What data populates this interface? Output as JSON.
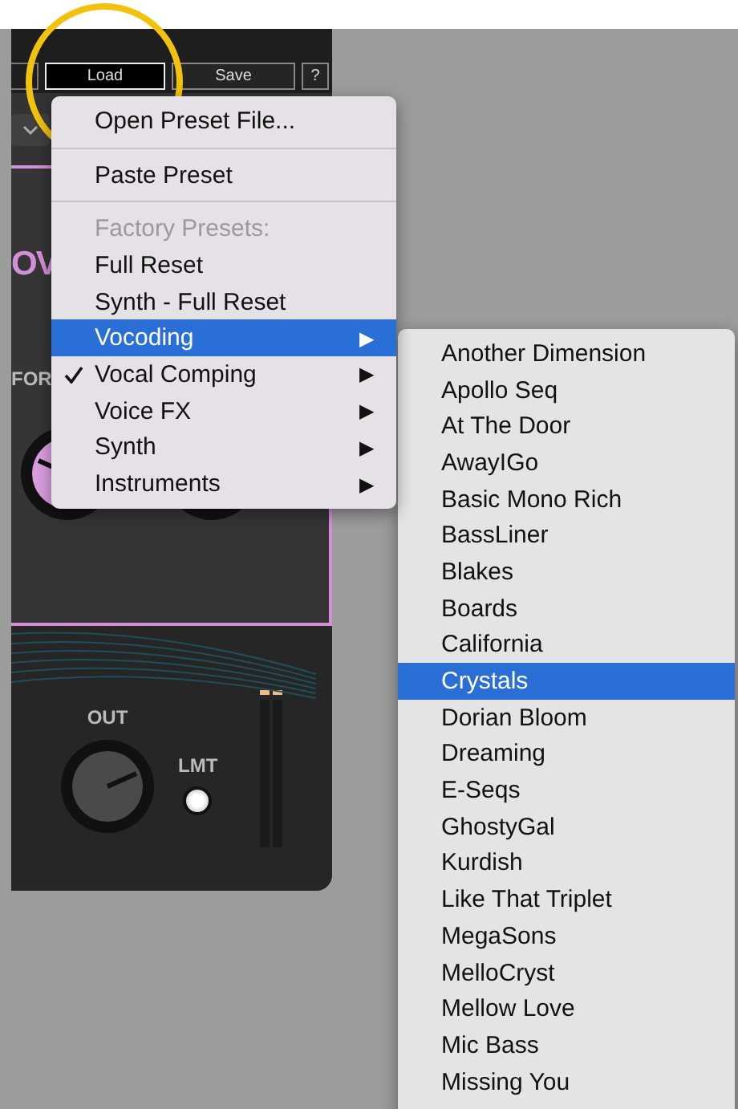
{
  "plugin": {
    "toolbar": [
      {
        "label": "Load",
        "active": true
      },
      {
        "label": "Save",
        "active": false
      },
      {
        "label": "?",
        "active": false
      }
    ],
    "title_fragment": "OV",
    "knob_label": "FOR",
    "output": {
      "label": "OUT"
    },
    "limiter": {
      "label": "LMT",
      "on": true
    }
  },
  "menu": {
    "items": [
      {
        "kind": "item",
        "label": "Open Preset File..."
      },
      {
        "kind": "separator"
      },
      {
        "kind": "item",
        "label": "Paste Preset"
      },
      {
        "kind": "separator"
      },
      {
        "kind": "header",
        "label": "Factory Presets:"
      },
      {
        "kind": "item",
        "label": "Full Reset",
        "selected": false,
        "checked": false
      },
      {
        "kind": "item",
        "label": "Synth - Full Reset",
        "selected": false,
        "checked": false
      },
      {
        "kind": "submenu",
        "label": "Vocoding",
        "arrow": "▶",
        "selected": true,
        "checked": false
      },
      {
        "kind": "submenu",
        "label": "Vocal Comping",
        "arrow": "▶",
        "selected": false,
        "checked": true
      },
      {
        "kind": "submenu",
        "label": "Voice FX",
        "arrow": "▶",
        "selected": false,
        "checked": false
      },
      {
        "kind": "submenu",
        "label": "Synth",
        "arrow": "▶",
        "selected": false,
        "checked": false
      },
      {
        "kind": "submenu",
        "label": "Instruments",
        "arrow": "▶",
        "selected": false,
        "checked": false
      }
    ]
  },
  "submenu": {
    "items": [
      {
        "label": "Another Dimension",
        "selected": false
      },
      {
        "label": "Apollo Seq",
        "selected": false
      },
      {
        "label": "At The Door",
        "selected": false
      },
      {
        "label": "AwayIGo",
        "selected": false
      },
      {
        "label": "Basic Mono Rich",
        "selected": false
      },
      {
        "label": "BassLiner",
        "selected": false
      },
      {
        "label": "Blakes",
        "selected": false
      },
      {
        "label": "Boards",
        "selected": false
      },
      {
        "label": "California",
        "selected": false
      },
      {
        "label": "Crystals",
        "selected": true
      },
      {
        "label": "Dorian Bloom",
        "selected": false
      },
      {
        "label": "Dreaming",
        "selected": false
      },
      {
        "label": "E-Seqs",
        "selected": false
      },
      {
        "label": "GhostyGal",
        "selected": false
      },
      {
        "label": "Kurdish",
        "selected": false
      },
      {
        "label": "Like That Triplet",
        "selected": false
      },
      {
        "label": "MegaSons",
        "selected": false
      },
      {
        "label": "MelloCryst",
        "selected": false
      },
      {
        "label": "Mellow Love",
        "selected": false
      },
      {
        "label": "Mic Bass",
        "selected": false
      },
      {
        "label": "Missing You",
        "selected": false
      }
    ]
  }
}
